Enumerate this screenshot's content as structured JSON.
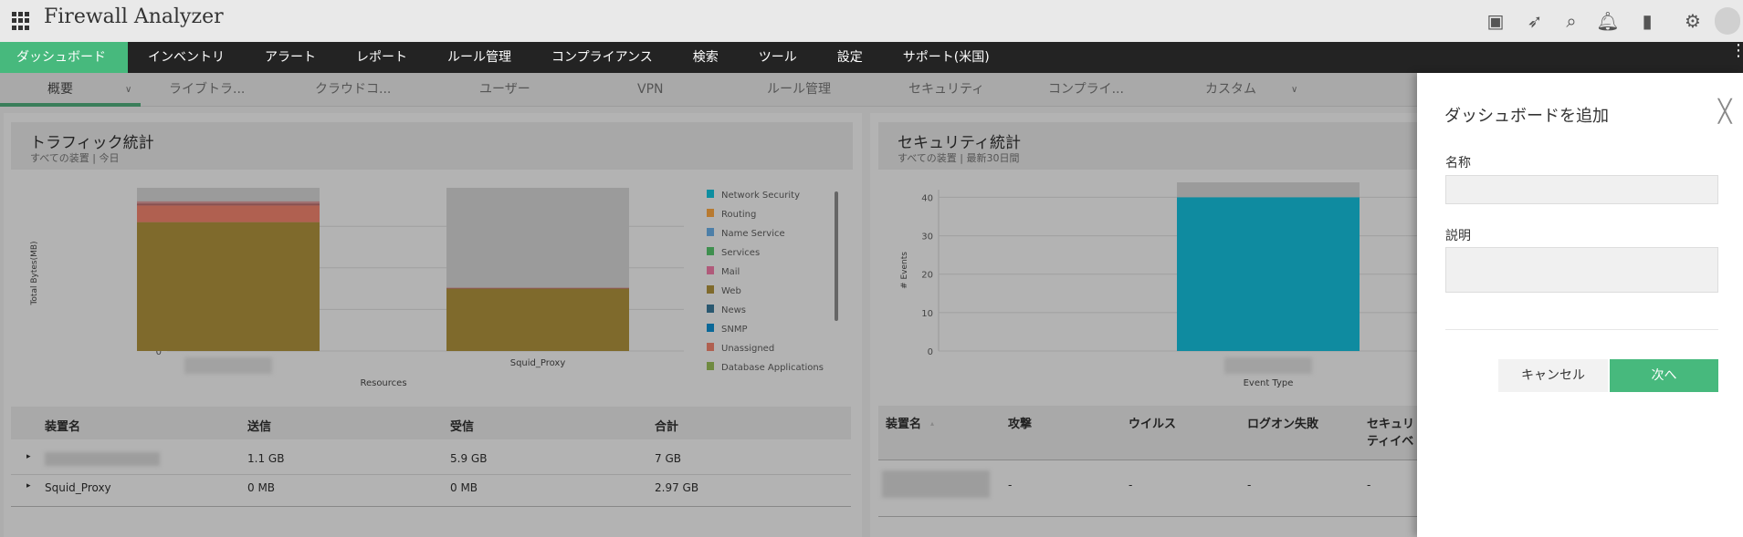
{
  "app": {
    "title": "Firewall Analyzer",
    "icons": [
      "presentation-icon",
      "rocket-icon",
      "search-icon",
      "bell-icon",
      "battery-icon",
      "gear-icon",
      "user-avatar-icon"
    ]
  },
  "nav": [
    "ダッシュボード",
    "インベントリ",
    "アラート",
    "レポート",
    "ルール管理",
    "コンプライアンス",
    "検索",
    "ツール",
    "設定",
    "サポート(米国)"
  ],
  "subtabs": [
    "概要",
    "ライブトラ...",
    "クラウドコ...",
    "ユーザー",
    "VPN",
    "ルール管理",
    "セキュリティ",
    "コンプライ...",
    "カスタム"
  ],
  "traffic": {
    "title": "トラフィック統計",
    "subtitle": "すべての装置 | 今日",
    "table": {
      "headers": [
        "装置名",
        "送信",
        "受信",
        "合計"
      ],
      "rows": [
        [
          "",
          "1.1 GB",
          "5.9 GB",
          "7 GB"
        ],
        [
          "Squid_Proxy",
          "0 MB",
          "0 MB",
          "2.97 GB"
        ]
      ]
    }
  },
  "security": {
    "title": "セキュリティ統計",
    "subtitle": "すべての装置 | 最新30日間",
    "table": {
      "headers": [
        "装置名",
        "攻撃",
        "ウイルス",
        "ログオン失敗",
        "セキュリティイベント"
      ],
      "rows": [
        [
          "",
          "-",
          "-",
          "-",
          "-"
        ]
      ]
    }
  },
  "drawer": {
    "title": "ダッシュボードを追加",
    "name_label": "名称",
    "name_value": "",
    "desc_label": "説明",
    "desc_value": "",
    "cancel": "キャンセル",
    "next": "次へ"
  },
  "chart_data": [
    {
      "type": "bar",
      "stacked": true,
      "title": "トラフィック統計",
      "xlabel": "Resources",
      "ylabel": "Total Bytes(MB)",
      "ylim": [
        0,
        7500
      ],
      "yticks": [
        0,
        2000,
        4000,
        6000
      ],
      "categories": [
        "",
        "Squid_Proxy"
      ],
      "series": [
        {
          "name": "Web",
          "color": "#7f6a2c",
          "values": [
            6200,
            3000
          ]
        },
        {
          "name": "Unassigned",
          "color": "#b06050",
          "values": [
            800,
            0
          ]
        },
        {
          "name": "News",
          "color": "#8a5050",
          "values": [
            100,
            30
          ]
        },
        {
          "name": "Mail",
          "color": "#a07070",
          "values": [
            100,
            20
          ]
        }
      ],
      "legend": [
        "Network Security",
        "Routing",
        "Name Service",
        "Services",
        "Mail",
        "Web",
        "News",
        "SNMP",
        "Unassigned",
        "Database Applications"
      ],
      "legend_colors": [
        "#0e8ea0",
        "#b87a30",
        "#4d7fa8",
        "#3f8f4f",
        "#b05a7a",
        "#7f6a2c",
        "#2a5870",
        "#0a6898",
        "#b06050",
        "#6f8a40"
      ],
      "legend_position": "right"
    },
    {
      "type": "bar",
      "title": "セキュリティ統計",
      "xlabel": "Event Type",
      "ylabel": "# Events",
      "ylim": [
        0,
        42
      ],
      "yticks": [
        0,
        10,
        20,
        30,
        40
      ],
      "categories": [
        ""
      ],
      "series": [
        {
          "name": "Events",
          "color": "#0f8ba0",
          "values": [
            40
          ]
        }
      ]
    }
  ]
}
